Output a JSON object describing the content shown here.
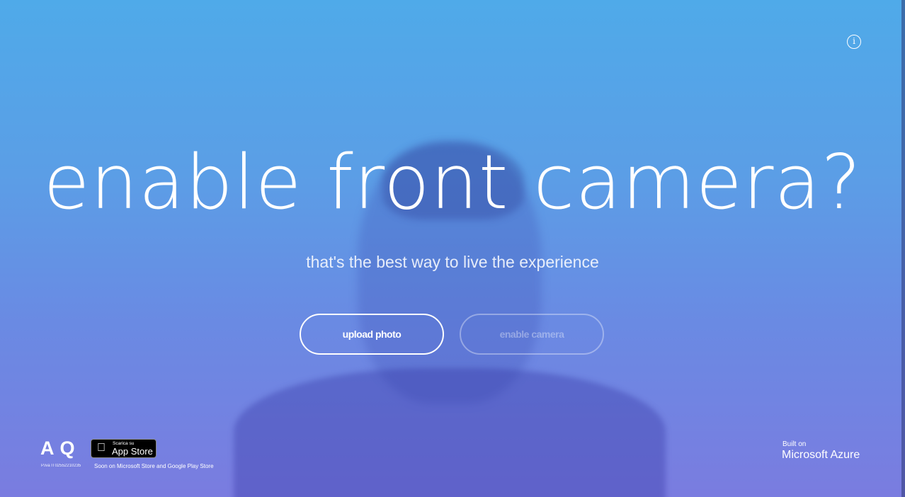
{
  "title": "enable front camera?",
  "subtitle": "that's the best way to live the experience",
  "buttons": {
    "upload": "upload photo",
    "camera": "enable camera"
  },
  "info_icon": "i",
  "footer": {
    "logo": "AQ",
    "piva": "P.iva IT02552210235",
    "appstore_small": "Scarica su",
    "appstore_big": "App Store",
    "soon": "Soon on Microsoft Store and Google Play Store",
    "built_on": "Built on",
    "azure": "Microsoft Azure"
  }
}
